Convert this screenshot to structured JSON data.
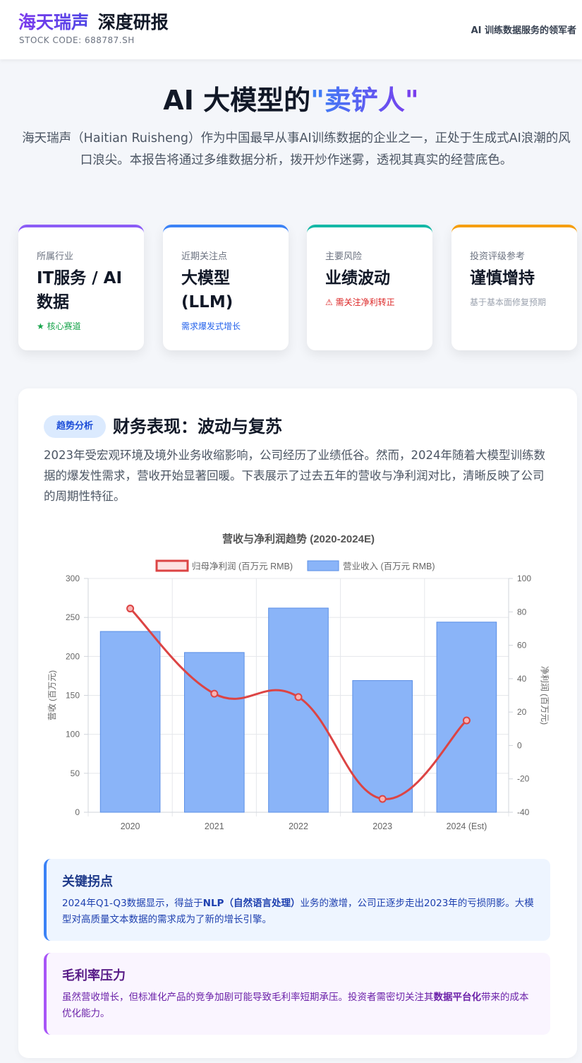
{
  "header": {
    "brand_name": "海天瑞声",
    "brand_sub": "深度研报",
    "stock_code": "STOCK CODE: 688787.SH",
    "slogan": "AI 训练数据服务的领军者"
  },
  "hero": {
    "title_pre": "AI 大模型的",
    "title_highlight": "\"卖铲人\"",
    "description": "海天瑞声（Haitian Ruisheng）作为中国最早从事AI训练数据的企业之一，正处于生成式AI浪潮的风口浪尖。本报告将通过多维数据分析，拨开炒作迷雾，透视其真实的经营底色。"
  },
  "cards": [
    {
      "label": "所属行业",
      "value": "IT服务 / AI数据",
      "note": "★ 核心赛道",
      "accent": "#8b5cf6",
      "note_color": "#16a34a"
    },
    {
      "label": "近期关注点",
      "value": "大模型 (LLM)",
      "note": "需求爆发式增长",
      "accent": "#3b82f6",
      "note_color": "#2563eb"
    },
    {
      "label": "主要风险",
      "value": "业绩波动",
      "note": "⚠ 需关注净利转正",
      "accent": "#14b8a6",
      "note_color": "#dc2626"
    },
    {
      "label": "投资评级参考",
      "value": "谨慎增持",
      "note": "基于基本面修复预期",
      "accent": "#f59e0b",
      "note_color": "#9ca3af"
    }
  ],
  "section": {
    "tag": "趋势分析",
    "title": "财务表现：波动与复苏",
    "description": "2023年受宏观环境及境外业务收缩影响，公司经历了业绩低谷。然而，2024年随着大模型训练数据的爆发性需求，营收开始显著回暖。下表展示了过去五年的营收与净利润对比，清晰反映了公司的周期性特征。"
  },
  "chart_data": {
    "type": "bar",
    "title": "营收与净利润趋势 (2020-2024E)",
    "categories": [
      "2020",
      "2021",
      "2022",
      "2023",
      "2024 (Est)"
    ],
    "series": [
      {
        "name": "营业收入 (百万元 RMB)",
        "type": "bar",
        "axis": "left",
        "values": [
          232,
          205,
          262,
          169,
          244
        ],
        "color": "#8ab4f8",
        "border": "#5b8fe6"
      },
      {
        "name": "归母净利润 (百万元 RMB)",
        "type": "line",
        "axis": "right",
        "values": [
          82,
          31,
          29,
          -32,
          15
        ],
        "color": "#dc4444"
      }
    ],
    "ylabel": "营收 (百万元)",
    "y2label": "净利润 (百万元)",
    "ylim": [
      0,
      300
    ],
    "y2lim": [
      -40,
      100
    ],
    "yticks": [
      0,
      50,
      100,
      150,
      200,
      250,
      300
    ],
    "y2ticks": [
      -40,
      -20,
      0,
      20,
      40,
      60,
      80,
      100
    ],
    "grid": true,
    "legend": "top"
  },
  "insights": [
    {
      "title": "关键拐点",
      "text_pre": "2024年Q1-Q3数据显示，得益于",
      "text_bold": "NLP（自然语言处理）",
      "text_post": "业务的激增，公司正逐步走出2023年的亏损阴影。大模型对高质量文本数据的需求成为了新的增长引擎。"
    },
    {
      "title": "毛利率压力",
      "text_pre": "虽然营收增长，但标准化产品的竞争加剧可能导致毛利率短期承压。投资者需密切关注其",
      "text_bold": "数据平台化",
      "text_post": "带来的成本优化能力。"
    }
  ]
}
